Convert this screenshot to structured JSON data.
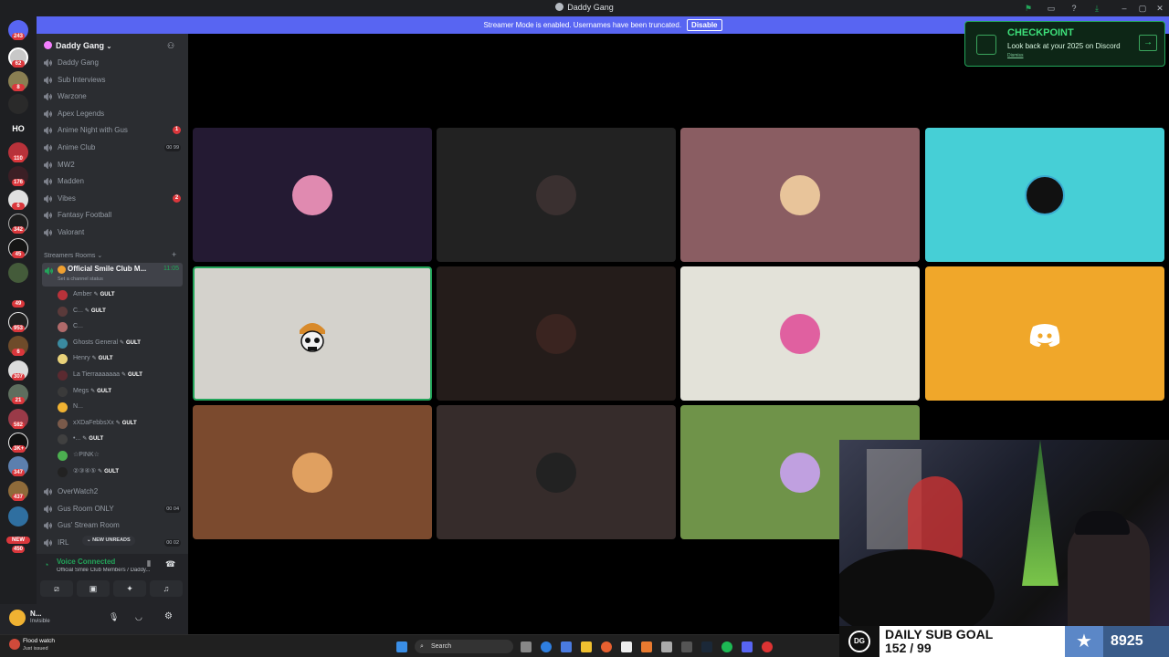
{
  "window": {
    "title": "Daddy Gang",
    "controls": [
      "green-flag-icon",
      "monitor-icon",
      "help-icon",
      "download-icon",
      "minimize-icon",
      "maximize-icon",
      "close-icon"
    ]
  },
  "banner": {
    "text": "Streamer Mode is enabled. Usernames have been truncated.",
    "button": "Disable"
  },
  "servers": {
    "top_badge": "243",
    "badges": [
      "62",
      "8",
      "110",
      "176",
      "6",
      "342",
      "45",
      "49",
      "953",
      "6",
      "307",
      "21",
      "582",
      "3K+",
      "347",
      "437",
      "450"
    ],
    "text_server": "HO",
    "new_label": "NEW"
  },
  "sidebar": {
    "guild_name": "Daddy Gang",
    "channels": [
      {
        "name": "Daddy Gang"
      },
      {
        "name": "Sub Interviews"
      },
      {
        "name": "Warzone"
      },
      {
        "name": "Apex Legends"
      },
      {
        "name": "Anime Night with Gus",
        "badge": "1"
      },
      {
        "name": "Anime Club",
        "pill": "00 99"
      },
      {
        "name": "MW2"
      },
      {
        "name": "Madden"
      },
      {
        "name": "Vibes",
        "badge": "2"
      },
      {
        "name": "Fantasy Football"
      },
      {
        "name": "Valorant"
      }
    ],
    "category": "Streamers Rooms",
    "active_channel": {
      "name": "Official Smile Club M...",
      "time": "11:05",
      "status": "Set a channel status"
    },
    "voice_users": [
      {
        "name": "Amber",
        "tag": "GULT"
      },
      {
        "name": "C...",
        "tag": "GULT"
      },
      {
        "name": "C...",
        "tag": ""
      },
      {
        "name": "Ghosts General",
        "tag": "GULT"
      },
      {
        "name": "Henry",
        "tag": "GULT"
      },
      {
        "name": "La Tierraaaaaaa",
        "tag": "GULT"
      },
      {
        "name": "Megs",
        "tag": "GULT"
      },
      {
        "name": "N...",
        "tag": ""
      },
      {
        "name": "xXDaFebbsXx",
        "tag": "GULT"
      },
      {
        "name": "•...",
        "tag": "GULT"
      },
      {
        "name": "☆PINK☆",
        "tag": ""
      },
      {
        "name": "②③④⑤",
        "tag": "GULT"
      }
    ],
    "channels_after": [
      {
        "name": "OverWatch2"
      },
      {
        "name": "Gus Room ONLY",
        "pill": "00 04"
      },
      {
        "name": "Gus' Stream Room"
      },
      {
        "name": "IRL",
        "pill": "00 02"
      }
    ],
    "new_unreads": "NEW UNREADS"
  },
  "voice_panel": {
    "status": "Voice Connected",
    "location": "Official Smile Club Members / Daddy..."
  },
  "user_panel": {
    "name": "N...",
    "status": "Invisible"
  },
  "checkpoint": {
    "title": "CHECKPOINT",
    "subtitle": "Look back at your 2025 on Discord",
    "dismiss": "Dismiss"
  },
  "sub_goal": {
    "title": "DAILY SUB GOAL",
    "progress": "152 / 99",
    "count": "8925"
  },
  "taskbar": {
    "weather_title": "Flood watch",
    "weather_sub": "Just issued",
    "search": "Search"
  },
  "colors": {
    "tile_bgs": [
      "#241a33",
      "#222222",
      "#8a5d62",
      "#46cfd6",
      "#d4d2cc",
      "#241c1a",
      "#e3e2d9",
      "#f0a72a",
      "#7b4a2e",
      "#362c2b",
      "#6f9349"
    ],
    "accent": "#5865f2",
    "voice_green": "#23a55a"
  }
}
